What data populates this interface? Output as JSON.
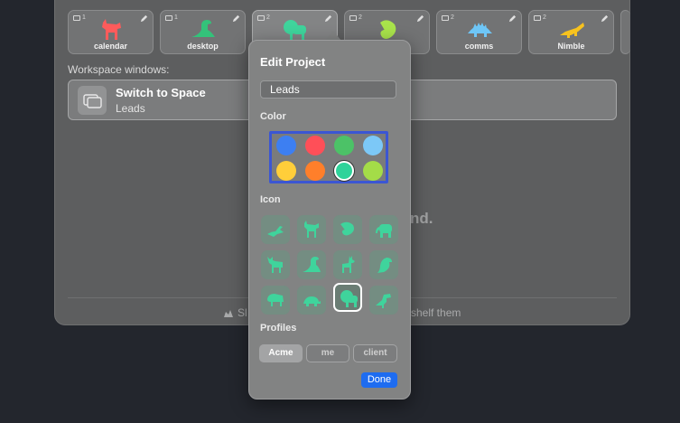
{
  "spaces": [
    {
      "label": "calendar",
      "count": "1",
      "animal": "goat",
      "color": "#ff5b5b"
    },
    {
      "label": "desktop",
      "count": "1",
      "animal": "dino",
      "color": "#33c27a"
    },
    {
      "label": "",
      "count": "2",
      "animal": "lion",
      "color": "#3fd49c"
    },
    {
      "label": "",
      "count": "2",
      "animal": "chameleon",
      "color": "#a9e34b"
    },
    {
      "label": "comms",
      "count": "2",
      "animal": "stego",
      "color": "#6ec6f7"
    },
    {
      "label": "Nimble",
      "count": "2",
      "animal": "croc",
      "color": "#f7c21e"
    }
  ],
  "workspace": {
    "section_label": "Workspace windows:",
    "row_title": "Switch to Space",
    "row_subtitle": "Leads"
  },
  "empty_message": "nd.",
  "footer": {
    "left_text": "Sl",
    "right_text": "shelf them"
  },
  "popover": {
    "title": "Edit Project",
    "name_value": "Leads",
    "color_label": "Color",
    "icon_label": "Icon",
    "profiles_label": "Profiles",
    "done_label": "Done",
    "colors": [
      "#3d7ff2",
      "#ff4f58",
      "#4cc267",
      "#7cc8f7",
      "#ffce3a",
      "#ff7f2a",
      "#2fd39a",
      "#a4dc48"
    ],
    "selected_color": 6,
    "icon_tint": "#3fd49c",
    "icons": [
      "bird",
      "goat",
      "chameleon",
      "elephant",
      "moose",
      "dino",
      "deer",
      "parrot",
      "bison",
      "turtle",
      "lion",
      "trex"
    ],
    "selected_icon": 10,
    "profiles": [
      {
        "label": "Acme",
        "active": true
      },
      {
        "label": "me",
        "active": false
      },
      {
        "label": "client",
        "active": false
      }
    ]
  }
}
